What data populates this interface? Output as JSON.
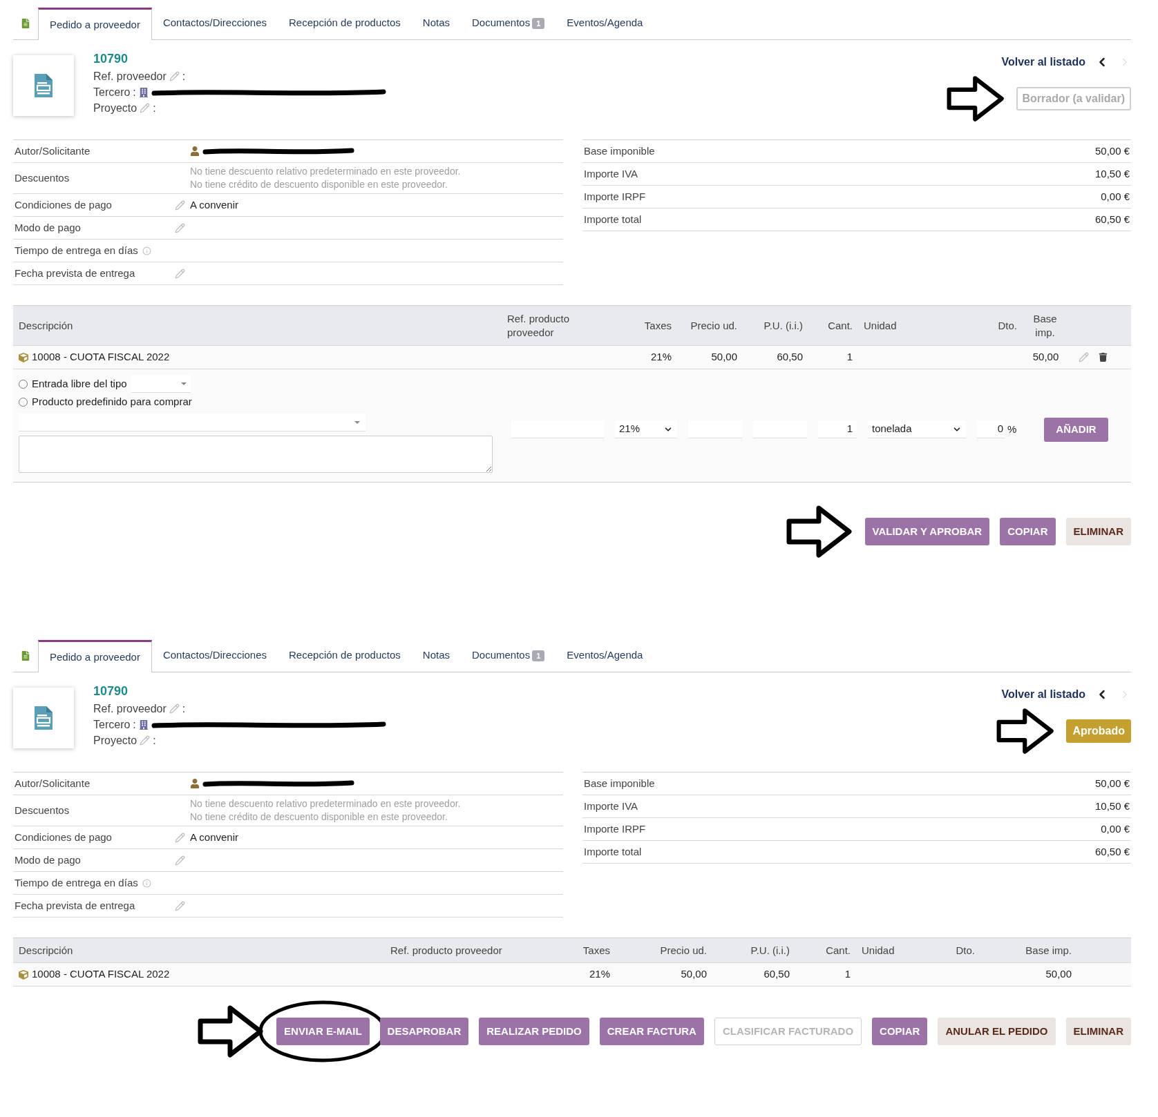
{
  "panels": [
    {
      "tabs": [
        {
          "label": "Pedido a proveedor",
          "selected": true
        },
        {
          "label": "Contactos/Direcciones",
          "selected": false
        },
        {
          "label": "Recepción de productos",
          "selected": false
        },
        {
          "label": "Notas",
          "selected": false
        },
        {
          "label": "Documentos",
          "badge": "1",
          "selected": false
        },
        {
          "label": "Eventos/Agenda",
          "selected": false
        }
      ],
      "ref": "10790",
      "ref_lines": [
        {
          "label": "Ref. proveedor",
          "kind": "editable",
          "separator": ":"
        },
        {
          "label": "Tercero",
          "kind": "redacted",
          "separator": ":"
        },
        {
          "label": "Proyecto",
          "kind": "editable",
          "separator": ":"
        }
      ],
      "back_link": "Volver al listado",
      "status": {
        "label": "Borrador (a validar)",
        "kind": "draft",
        "arrow": true
      },
      "fields": [
        {
          "label": "Autor/Solicitante",
          "kind": "user"
        },
        {
          "label": "Descuentos",
          "kind": "notes",
          "notes": [
            "No tiene descuento relativo predeterminado en este proveedor.",
            "No tiene crédito de descuento disponible en este proveedor."
          ]
        },
        {
          "label": "Condiciones de pago",
          "kind": "editable",
          "value": "A convenir"
        },
        {
          "label": "Modo de pago",
          "kind": "editable"
        },
        {
          "label": "Tiempo de entrega en días",
          "kind": "info"
        },
        {
          "label": "Fecha prevista de entrega",
          "kind": "editable"
        }
      ],
      "totals": [
        {
          "label": "Base imponible",
          "value": "50,00 €"
        },
        {
          "label": "Importe IVA",
          "value": "10,50 €"
        },
        {
          "label": "Importe IRPF",
          "value": "0,00 €"
        },
        {
          "label": "Importe total",
          "value": "60,50 €"
        }
      ],
      "table": {
        "kind": "edit",
        "columns": [
          "Descripción",
          "Ref. producto proveedor",
          "Taxes",
          "Precio ud.",
          "P.U. (i.i.)",
          "Cant.",
          "Unidad",
          "Dto.",
          "Base imp."
        ],
        "rows": [
          {
            "description": "10008 - CUOTA FISCAL 2022",
            "tax": "21%",
            "price": "50,00",
            "price_tax": "60,50",
            "qty": "1",
            "base": "50,00",
            "actions": true
          }
        ]
      },
      "add_line": {
        "options": [
          {
            "label": "Entrada libre del tipo",
            "selected": false,
            "select": true
          },
          {
            "label": "Producto predefinido para comprar",
            "selected": false,
            "select": false
          }
        ],
        "tax": "21%",
        "qty": "1",
        "unit": "tonelada",
        "discount": "0",
        "percent": "%",
        "button": "AÑADIR"
      },
      "actions": {
        "arrow": true,
        "buttons": [
          {
            "label": "VALIDAR Y APROBAR",
            "kind": "primary",
            "circled": false
          },
          {
            "label": "COPIAR",
            "kind": "primary",
            "circled": false
          },
          {
            "label": "ELIMINAR",
            "kind": "danger",
            "circled": false
          }
        ]
      }
    },
    {
      "tabs": [
        {
          "label": "Pedido a proveedor",
          "selected": true
        },
        {
          "label": "Contactos/Direcciones",
          "selected": false
        },
        {
          "label": "Recepción de productos",
          "selected": false
        },
        {
          "label": "Notas",
          "selected": false
        },
        {
          "label": "Documentos",
          "badge": "1",
          "selected": false
        },
        {
          "label": "Eventos/Agenda",
          "selected": false
        }
      ],
      "ref": "10790",
      "ref_lines": [
        {
          "label": "Ref. proveedor",
          "kind": "editable",
          "separator": ":"
        },
        {
          "label": "Tercero",
          "kind": "redacted",
          "separator": ":"
        },
        {
          "label": "Proyecto",
          "kind": "editable",
          "separator": ":"
        }
      ],
      "back_link": "Volver al listado",
      "status": {
        "label": "Aprobado",
        "kind": "approved",
        "arrow": true
      },
      "fields": [
        {
          "label": "Autor/Solicitante",
          "kind": "user"
        },
        {
          "label": "Descuentos",
          "kind": "notes",
          "notes": [
            "No tiene descuento relativo predeterminado en este proveedor.",
            "No tiene crédito de descuento disponible en este proveedor."
          ]
        },
        {
          "label": "Condiciones de pago",
          "kind": "editable",
          "value": "A convenir"
        },
        {
          "label": "Modo de pago",
          "kind": "editable"
        },
        {
          "label": "Tiempo de entrega en días",
          "kind": "info"
        },
        {
          "label": "Fecha prevista de entrega",
          "kind": "editable"
        }
      ],
      "totals": [
        {
          "label": "Base imponible",
          "value": "50,00 €"
        },
        {
          "label": "Importe IVA",
          "value": "10,50 €"
        },
        {
          "label": "Importe IRPF",
          "value": "0,00 €"
        },
        {
          "label": "Importe total",
          "value": "60,50 €"
        }
      ],
      "table": {
        "kind": "view",
        "columns": [
          "Descripción",
          "Ref. producto proveedor",
          "Taxes",
          "Precio ud.",
          "P.U. (i.i.)",
          "Cant.",
          "Unidad",
          "Dto.",
          "Base imp."
        ],
        "rows": [
          {
            "description": "10008 - CUOTA FISCAL 2022",
            "tax": "21%",
            "price": "50,00",
            "price_tax": "60,50",
            "qty": "1",
            "base": "50,00",
            "actions": false
          }
        ]
      },
      "actions": {
        "arrow": true,
        "buttons": [
          {
            "label": "ENVIAR E-MAIL",
            "kind": "primary",
            "circled": true
          },
          {
            "label": "DESAPROBAR",
            "kind": "primary",
            "circled": false
          },
          {
            "label": "REALIZAR PEDIDO",
            "kind": "primary",
            "circled": false
          },
          {
            "label": "CREAR FACTURA",
            "kind": "primary",
            "circled": false
          },
          {
            "label": "CLASIFICAR FACTURADO",
            "kind": "disabled",
            "circled": false
          },
          {
            "label": "COPIAR",
            "kind": "primary",
            "circled": false
          },
          {
            "label": "ANULAR EL PEDIDO",
            "kind": "danger",
            "circled": false
          },
          {
            "label": "ELIMINAR",
            "kind": "danger",
            "circled": false
          }
        ]
      }
    }
  ]
}
